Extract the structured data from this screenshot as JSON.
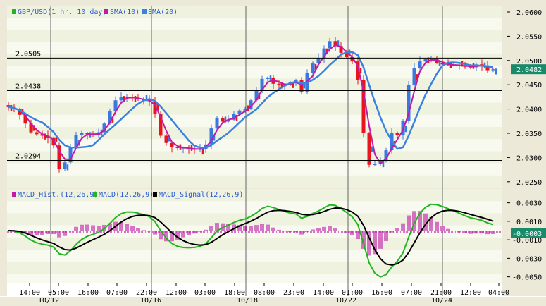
{
  "chart_data": [
    {
      "type": "candlestick",
      "title": "GBP/USD price with SMA(10), SMA(20)",
      "legend": [
        {
          "label": "GBP/USD(1 hr.  10 day)",
          "color": "#22b422"
        },
        {
          "label": "SMA(10)",
          "color": "#c01aa8"
        },
        {
          "label": "SMA(20)",
          "color": "#3a82e0"
        }
      ],
      "ylim": [
        2.0235,
        2.061
      ],
      "yticks": [
        "2.0600",
        "2.0550",
        "2.0500",
        "2.0450",
        "2.0400",
        "2.0350",
        "2.0300",
        "2.0250"
      ],
      "ytick_values": [
        2.06,
        2.055,
        2.05,
        2.045,
        2.04,
        2.035,
        2.03,
        2.025
      ],
      "hlines": [
        {
          "value": 2.0505,
          "label": "2.0505"
        },
        {
          "value": 2.0438,
          "label": "2.0438"
        },
        {
          "value": 2.0294,
          "label": "2.0294"
        }
      ],
      "current": {
        "value": 2.0482,
        "label": "2.0482"
      },
      "closes": [
        2.0404,
        2.04,
        2.0388,
        2.037,
        2.0352,
        2.0348,
        2.0345,
        2.034,
        2.0325,
        2.0276,
        2.029,
        2.0322,
        2.0346,
        2.035,
        2.0348,
        2.0346,
        2.0352,
        2.037,
        2.0395,
        2.0418,
        2.0425,
        2.0425,
        2.0422,
        2.042,
        2.0418,
        2.0416,
        2.039,
        2.0345,
        2.033,
        2.0321,
        2.032,
        2.032,
        2.0318,
        2.0316,
        2.0318,
        2.0327,
        2.036,
        2.0382,
        2.0374,
        2.0378,
        2.039,
        2.0397,
        2.04,
        2.0418,
        2.0438,
        2.0462,
        2.0465,
        2.0452,
        2.045,
        2.045,
        2.0455,
        2.046,
        2.0436,
        2.0475,
        2.0495,
        2.0505,
        2.0525,
        2.054,
        2.053,
        2.0516,
        2.0507,
        2.0498,
        2.046,
        2.035,
        2.0285,
        2.0286,
        2.0292,
        2.0315,
        2.035,
        2.0346,
        2.0375,
        2.045,
        2.0485,
        2.0498,
        2.0503,
        2.0504,
        2.0495,
        2.0492,
        2.0491,
        2.049,
        2.049,
        2.0487,
        2.0486,
        2.0492,
        2.049,
        2.048,
        2.0482
      ],
      "up_color": "#3a78e0",
      "down_color": "#e8141e"
    },
    {
      "type": "bar+line",
      "title": "MACD",
      "legend": [
        {
          "label": "MACD_Hist.(12,26,9)",
          "color": "#c01aa8"
        },
        {
          "label": "MACD(12,26,9)",
          "color": "#22b422"
        },
        {
          "label": "MACD_Signal(12,26,9)",
          "color": "#000000"
        }
      ],
      "ylim": [
        -0.006,
        0.0036
      ],
      "yticks": [
        "0.0030",
        "0.0010",
        "-0.0010",
        "-0.0030",
        "-0.0050"
      ],
      "ytick_values": [
        0.003,
        0.001,
        -0.001,
        -0.003,
        -0.005
      ],
      "current": {
        "value": -0.0003,
        "label": "-0.0003"
      }
    }
  ],
  "xaxis": {
    "times": [
      "14:00",
      "05:00",
      "16:00",
      "07:00",
      "22:00",
      "12:00",
      "03:00",
      "18:00",
      "08:00",
      "23:00",
      "14:00",
      "01:00",
      "16:00",
      "07:00",
      "21:00",
      "12:00",
      "04:00"
    ],
    "dates": [
      "10/12",
      "10/16",
      "10/18",
      "10/22",
      "10/24"
    ]
  },
  "colors": {
    "accent": "#1a8a6a"
  }
}
